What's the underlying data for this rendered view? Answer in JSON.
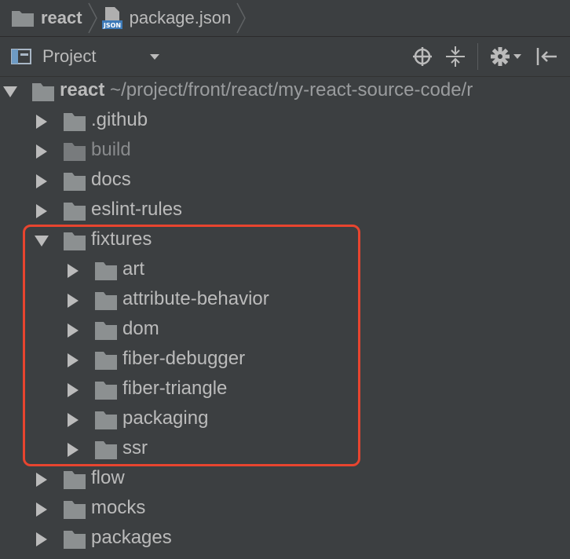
{
  "breadcrumb": {
    "project": "react",
    "file": "package.json",
    "file_icon_text": "JSON"
  },
  "toolbar": {
    "view_label": "Project",
    "icons": [
      "project-view-icon",
      "dropdown-triangle-icon",
      "locate-icon",
      "collapse-all-icon",
      "gear-icon",
      "hide-panel-icon"
    ]
  },
  "tree": {
    "root": {
      "name": "react",
      "path": "~/project/front/react/my-react-source-code/r"
    },
    "items": [
      {
        "name": ".github",
        "state": "collapsed",
        "depth": 1
      },
      {
        "name": "build",
        "state": "collapsed",
        "depth": 1,
        "excluded": true
      },
      {
        "name": "docs",
        "state": "collapsed",
        "depth": 1
      },
      {
        "name": "eslint-rules",
        "state": "collapsed",
        "depth": 1
      },
      {
        "name": "fixtures",
        "state": "expanded",
        "depth": 1
      },
      {
        "name": "art",
        "state": "collapsed",
        "depth": 2
      },
      {
        "name": "attribute-behavior",
        "state": "collapsed",
        "depth": 2
      },
      {
        "name": "dom",
        "state": "collapsed",
        "depth": 2
      },
      {
        "name": "fiber-debugger",
        "state": "collapsed",
        "depth": 2
      },
      {
        "name": "fiber-triangle",
        "state": "collapsed",
        "depth": 2
      },
      {
        "name": "packaging",
        "state": "collapsed",
        "depth": 2
      },
      {
        "name": "ssr",
        "state": "collapsed",
        "depth": 2
      },
      {
        "name": "flow",
        "state": "collapsed",
        "depth": 1
      },
      {
        "name": "mocks",
        "state": "collapsed",
        "depth": 1
      },
      {
        "name": "packages",
        "state": "collapsed",
        "depth": 1
      }
    ]
  },
  "colors": {
    "background": "#3c3f41",
    "text": "#bbbbbb",
    "folder": "#8c9091",
    "highlight": "#e8452f"
  }
}
